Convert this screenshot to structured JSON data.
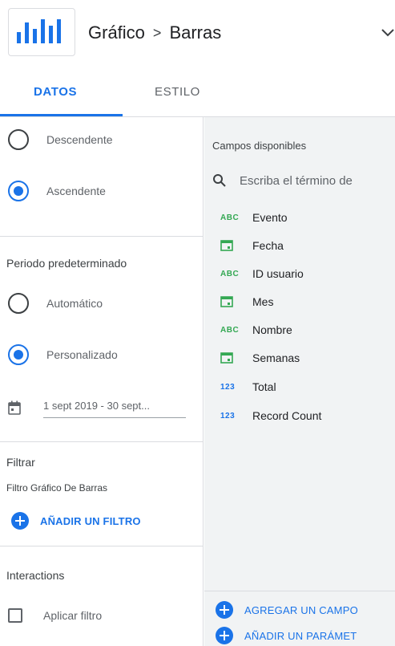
{
  "header": {
    "breadcrumb_parent": "Gráfico",
    "breadcrumb_separator": ">",
    "breadcrumb_current": "Barras"
  },
  "tabs": [
    {
      "label": "DATOS",
      "active": true
    },
    {
      "label": "ESTILO",
      "active": false
    }
  ],
  "sort_order": {
    "options": [
      {
        "label": "Descendente",
        "checked": false
      },
      {
        "label": "Ascendente",
        "checked": true
      }
    ]
  },
  "date_range": {
    "title": "Periodo predeterminado",
    "options": [
      {
        "label": "Automático",
        "checked": false
      },
      {
        "label": "Personalizado",
        "checked": true
      }
    ],
    "value": "1 sept 2019 - 30 sept..."
  },
  "filter": {
    "title": "Filtrar",
    "subtitle": "Filtro Gráfico De Barras",
    "add_label": "AÑADIR UN FILTRO"
  },
  "interactions": {
    "title": "Interactions",
    "checkbox_label": "Aplicar filtro",
    "checked": false
  },
  "fields_panel": {
    "title": "Campos disponibles",
    "search_placeholder": "Escriba el término de",
    "fields": [
      {
        "type": "text",
        "type_label": "ABC",
        "label": "Evento"
      },
      {
        "type": "date",
        "type_label": "",
        "label": "Fecha"
      },
      {
        "type": "text",
        "type_label": "ABC",
        "label": "ID usuario"
      },
      {
        "type": "date",
        "type_label": "",
        "label": "Mes"
      },
      {
        "type": "text",
        "type_label": "ABC",
        "label": "Nombre"
      },
      {
        "type": "date",
        "type_label": "",
        "label": "Semanas"
      },
      {
        "type": "number",
        "type_label": "123",
        "label": "Total"
      },
      {
        "type": "number",
        "type_label": "123",
        "label": "Record Count"
      }
    ],
    "add_field_label": "AGREGAR UN CAMPO",
    "add_param_label": "AÑADIR UN PARÁMET"
  },
  "colors": {
    "accent": "#1a73e8",
    "text_type": "#34a853",
    "date_type": "#34a853",
    "panel_bg": "#f1f3f4"
  }
}
